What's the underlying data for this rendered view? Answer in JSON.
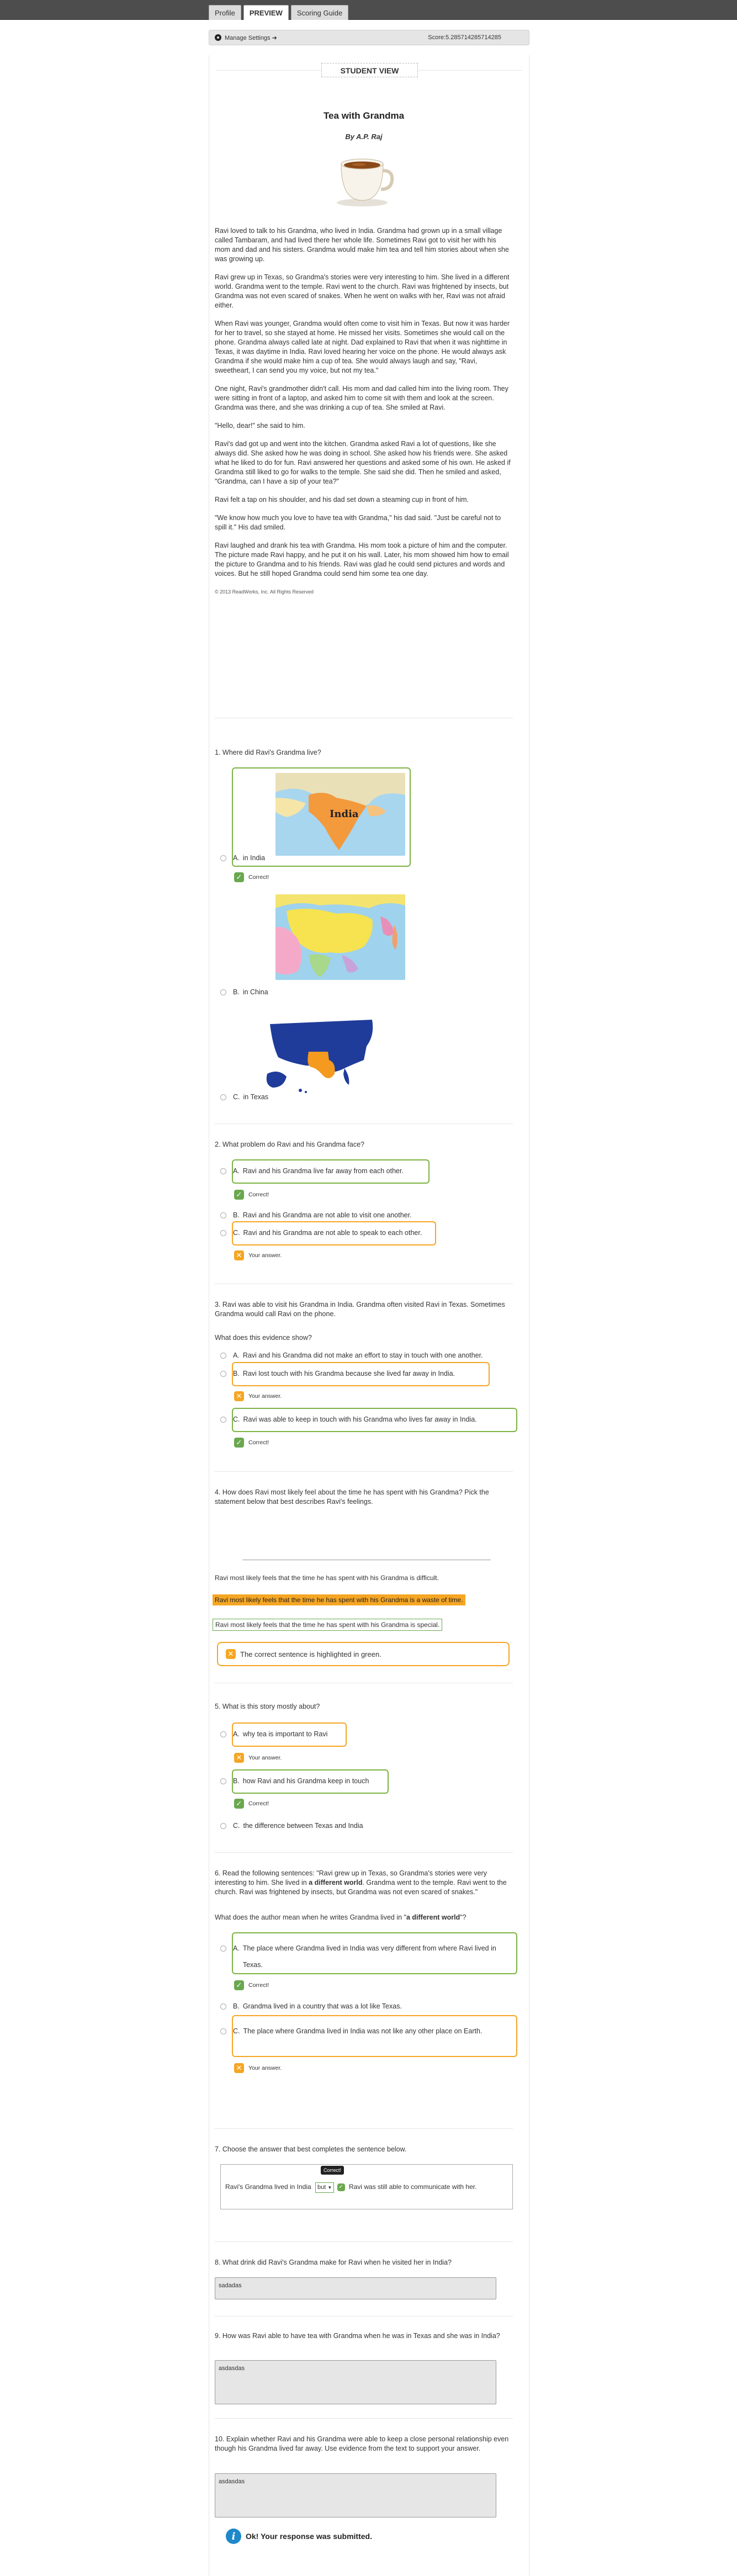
{
  "tabs": [
    {
      "label": "Profile"
    },
    {
      "label": "PREVIEW"
    },
    {
      "label": "Scoring Guide"
    }
  ],
  "settings": {
    "manage_label": "Manage Settings ➜",
    "score_label": "Score:",
    "score_value": "5.285714285714285"
  },
  "student_view": "STUDENT VIEW",
  "story": {
    "title": "Tea with Grandma",
    "author": "By A.P. Raj",
    "paragraphs": [
      "Ravi loved to talk to his Grandma, who lived in India. Grandma had grown up in a small village called Tambaram, and had lived there her whole life. Sometimes Ravi got to visit her with his mom and dad and his sisters. Grandma would make him tea and tell him stories about when she was growing up.",
      "Ravi grew up in Texas, so Grandma's stories were very interesting to him. She lived in a different world. Grandma went to the temple. Ravi went to the church. Ravi was frightened by insects, but Grandma was not even scared of snakes. When he went on walks with her, Ravi was not afraid either.",
      "When Ravi was younger, Grandma would often come to visit him in Texas. But now it was harder for her to travel, so she stayed at home. He missed her visits. Sometimes she would call on the phone. Grandma always called late at night. Dad explained to Ravi that when it was nighttime in Texas, it was daytime in India. Ravi loved hearing her voice on the phone. He would always ask Grandma if she would make him a cup of tea. She would always laugh and say, \"Ravi, sweetheart, I can send you my voice, but not my tea.\"",
      "One night, Ravi's grandmother didn't call. His mom and dad called him into the living room. They were sitting in front of a laptop, and asked him to come sit with them and look at the screen. Grandma was there, and she was drinking a cup of tea. She smiled at Ravi.",
      "\"Hello, dear!\" she said to him.",
      "Ravi's dad got up and went into the kitchen. Grandma asked Ravi a lot of questions, like she always did. She asked how he was doing in school. She asked how his friends were. She asked what he liked to do for fun. Ravi answered her questions and asked some of his own. He asked if Grandma still liked to go for walks to the temple. She said she did. Then he smiled and asked, \"Grandma, can I have a sip of your tea?\"",
      "Ravi felt a tap on his shoulder, and his dad set down a steaming cup in front of him.",
      "\"We know how much you love to have tea with Grandma,\" his dad said. \"Just be careful not to spill it.\" His dad smiled.",
      "Ravi laughed and drank his tea with Grandma. His mom took a picture of him and the computer. The picture made Ravi happy, and he put it on his wall. Later, his mom showed him how to email the picture to Grandma and to his friends. Ravi was glad he could send pictures and words and voices. But he still hoped Grandma could send him some tea one day."
    ],
    "copyright": "© 2013 ReadWorks, Inc. All Rights Reserved"
  },
  "q1": {
    "text": "1. Where did Ravi's Grandma live?",
    "map_label": "India",
    "options": [
      {
        "letter": "A.",
        "label": "in India"
      },
      {
        "letter": "B.",
        "label": "in China"
      },
      {
        "letter": "C.",
        "label": "in Texas"
      }
    ],
    "fb_correct": "Correct!"
  },
  "q2": {
    "text": "2. What problem do Ravi and his Grandma face?",
    "options": [
      {
        "letter": "A.",
        "label": "Ravi and his Grandma live far away from each other."
      },
      {
        "letter": "B.",
        "label": "Ravi and his Grandma are not able to visit one another."
      },
      {
        "letter": "C.",
        "label": "Ravi and his Grandma are not able to speak to each other."
      }
    ],
    "fb_correct": "Correct!",
    "fb_answer": "Your answer."
  },
  "q3": {
    "text": "3. Ravi was able to visit his Grandma in India. Grandma often visited Ravi in Texas. Sometimes Grandma would call Ravi on the phone.",
    "subtext": "What does this evidence show?",
    "options": [
      {
        "letter": "A.",
        "label": "Ravi and his Grandma did not make an effort to stay in touch with one another."
      },
      {
        "letter": "B.",
        "label": "Ravi lost touch with his Grandma because she lived far away in India."
      },
      {
        "letter": "C.",
        "label": "Ravi was able to keep in touch with his Grandma who lives far away in India."
      }
    ],
    "fb_answer": "Your answer.",
    "fb_correct": "Correct!"
  },
  "q4": {
    "text": "4. How does Ravi most likely feel about the time he has spent with his Grandma? Pick the statement below that best describes Ravi's feelings.",
    "sentences": [
      "Ravi most likely feels that the time he has spent with his Grandma is difficult.",
      "Ravi most likely feels that the time he has spent with his Grandma is a waste of time.",
      "Ravi most likely feels that the time he has spent with his Grandma is special."
    ],
    "feedback": "The correct sentence is highlighted in green."
  },
  "q5": {
    "text": "5. What is this story mostly about?",
    "options": [
      {
        "letter": "A.",
        "label": "why tea is important to Ravi"
      },
      {
        "letter": "B.",
        "label": "how Ravi and his Grandma keep in touch"
      },
      {
        "letter": "C.",
        "label": "the difference between Texas and India"
      }
    ],
    "fb_answer": "Your answer.",
    "fb_correct": "Correct!"
  },
  "q6": {
    "text_pre": "6. Read the following sentences: \"Ravi grew up in Texas, so Grandma's stories were very interesting to him. She lived in ",
    "text_bold": "a different world",
    "text_post": ". Grandma went to the temple. Ravi went to the church. Ravi was frightened by insects, but Grandma was not even scared of snakes.\"",
    "question_pre": "What does the author mean when he writes Grandma lived in \"",
    "question_bold": "a different world",
    "question_post": "\"?",
    "options": [
      {
        "letter": "A.",
        "label": "The place where Grandma lived in India was very different from where Ravi lived in Texas."
      },
      {
        "letter": "B.",
        "label": "Grandma lived in a country that was a lot like Texas."
      },
      {
        "letter": "C.",
        "label": "The place where Grandma lived in India was not like any other place on Earth."
      }
    ],
    "fb_correct": "Correct!",
    "fb_answer": "Your answer."
  },
  "q7": {
    "text": "7. Choose the answer that best completes the sentence below.",
    "sentence_pre": "Ravi's Grandma lived in India",
    "select_value": "but",
    "tooltip": "Correct!",
    "sentence_post": "Ravi was still able to communicate with her."
  },
  "q8": {
    "text": "8. What drink did Ravi's Grandma make for Ravi when he visited her in India?",
    "answer": "sadadas"
  },
  "q9": {
    "text": "9. How was Ravi able to have tea with Grandma when he was in Texas and she was in India?",
    "answer": "asdasdas"
  },
  "q10": {
    "text": "10. Explain whether Ravi and his Grandma were able to keep a close personal relationship even though his Grandma lived far away. Use evidence from the text to support your answer.",
    "answer": "asdasdas"
  },
  "submitted": "Ok! Your response was submitted."
}
